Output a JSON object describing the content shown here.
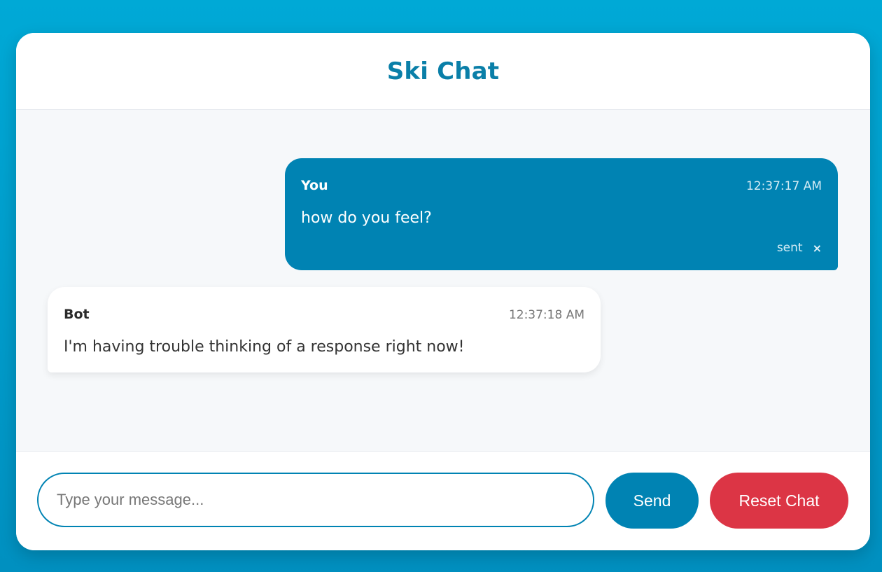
{
  "header": {
    "title": "Ski Chat"
  },
  "messages": [
    {
      "role": "user",
      "sender": "You",
      "time": "12:37:17 AM",
      "text": "how do you feel?",
      "status": "sent",
      "dismiss_icon": "×"
    },
    {
      "role": "bot",
      "sender": "Bot",
      "time": "12:37:18 AM",
      "text": "I'm having trouble thinking of a response right now!"
    }
  ],
  "composer": {
    "placeholder": "Type your message...",
    "value": "",
    "send_label": "Send",
    "reset_label": "Reset Chat"
  },
  "colors": {
    "accent": "#0083b3",
    "title": "#0a7fa8",
    "danger": "#dc3545",
    "background": "#00a9d6"
  }
}
